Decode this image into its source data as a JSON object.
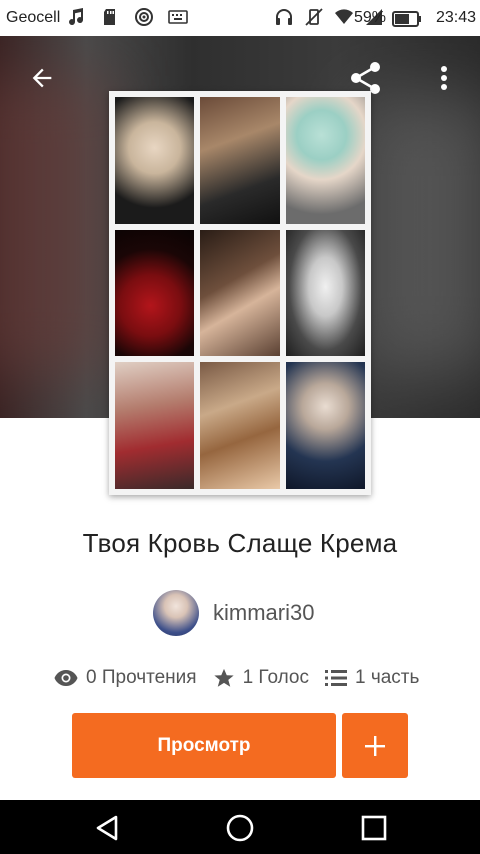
{
  "status_bar": {
    "carrier": "Geocell",
    "battery_percent": "59%",
    "time": "23:43",
    "icons_left": [
      "music-icon",
      "sd-card-icon",
      "radio-icon",
      "keyboard-icon"
    ],
    "icons_right": [
      "headset-icon",
      "vibrate-icon",
      "wifi-icon",
      "signal-icon",
      "battery-icon"
    ]
  },
  "toolbar": {
    "back_icon": "arrow-left-icon",
    "share_icon": "share-icon",
    "menu_icon": "more-vert-icon"
  },
  "story": {
    "title": "Твоя Кровь Слаще Крема",
    "author": "kimmari30",
    "reads": "0 Прочтения",
    "votes": "1 Голос",
    "parts": "1 часть"
  },
  "actions": {
    "view_label": "Просмотр",
    "add_icon": "plus-icon"
  },
  "navigation": {
    "back": "nav-back-icon",
    "home": "nav-home-icon",
    "recents": "nav-recents-icon"
  },
  "colors": {
    "accent": "#f46b20",
    "text_primary": "#222222",
    "text_secondary": "#555555",
    "nav_background": "#000000"
  }
}
